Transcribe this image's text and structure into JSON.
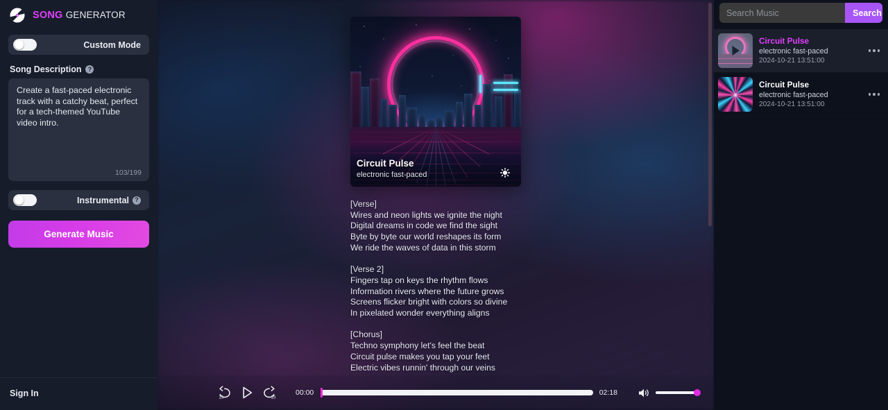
{
  "brand": {
    "word1": "SONG",
    "word2": "GENERATOR",
    "logo_icon": "vinyl-record-icon",
    "accent": "#e040fb"
  },
  "sidebar": {
    "custom_mode": {
      "label": "Custom Mode",
      "enabled": false
    },
    "song_description": {
      "label": "Song Description",
      "help_icon": "question-mark-icon",
      "value": "Create a fast-paced electronic track with a catchy beat, perfect for a tech-themed YouTube video intro.",
      "char_count": "103/199"
    },
    "instrumental": {
      "label": "Instrumental",
      "enabled": false,
      "help_icon": "question-mark-icon"
    },
    "generate_button": "Generate Music",
    "sign_in": "Sign In"
  },
  "player_card": {
    "title": "Circuit Pulse",
    "style": "electronic fast-paced",
    "sparkle_icon": "sparkle-icon",
    "lyrics": "[Verse]\nWires and neon lights we ignite the night\nDigital dreams in code we find the sight\nByte by byte our world reshapes its form\nWe ride the waves of data in this storm\n\n[Verse 2]\nFingers tap on keys the rhythm flows\nInformation rivers where the future grows\nScreens flicker bright with colors so divine\nIn pixelated wonder everything aligns\n\n[Chorus]\nTechno symphony let's feel the beat\nCircuit pulse makes you tap your feet\nElectric vibes runnin' through our veins"
  },
  "player": {
    "rewind_label": "15",
    "forward_label": "15",
    "rewind_icon": "rewind-15-icon",
    "play_icon": "play-icon",
    "forward_icon": "forward-15-icon",
    "current_time": "00:00",
    "total_time": "02:18",
    "progress_percent": 0,
    "volume_icon": "volume-icon",
    "volume_percent": 100,
    "accent": "#e22ae0"
  },
  "search": {
    "placeholder": "Search Music",
    "value": "",
    "button_label": "Search",
    "button_color": "#a855f7"
  },
  "tracks": [
    {
      "title": "Circuit Pulse",
      "style": "electronic fast-paced",
      "date": "2024-10-21 13:51:00",
      "active": true,
      "thumb": "synthwave-ring",
      "overlay_icon": "play-icon",
      "menu_icon": "more-options-icon"
    },
    {
      "title": "Circuit Pulse",
      "style": "electronic fast-paced",
      "date": "2024-10-21 13:51:00",
      "active": false,
      "thumb": "radial-burst",
      "overlay_icon": "",
      "menu_icon": "more-options-icon"
    }
  ]
}
